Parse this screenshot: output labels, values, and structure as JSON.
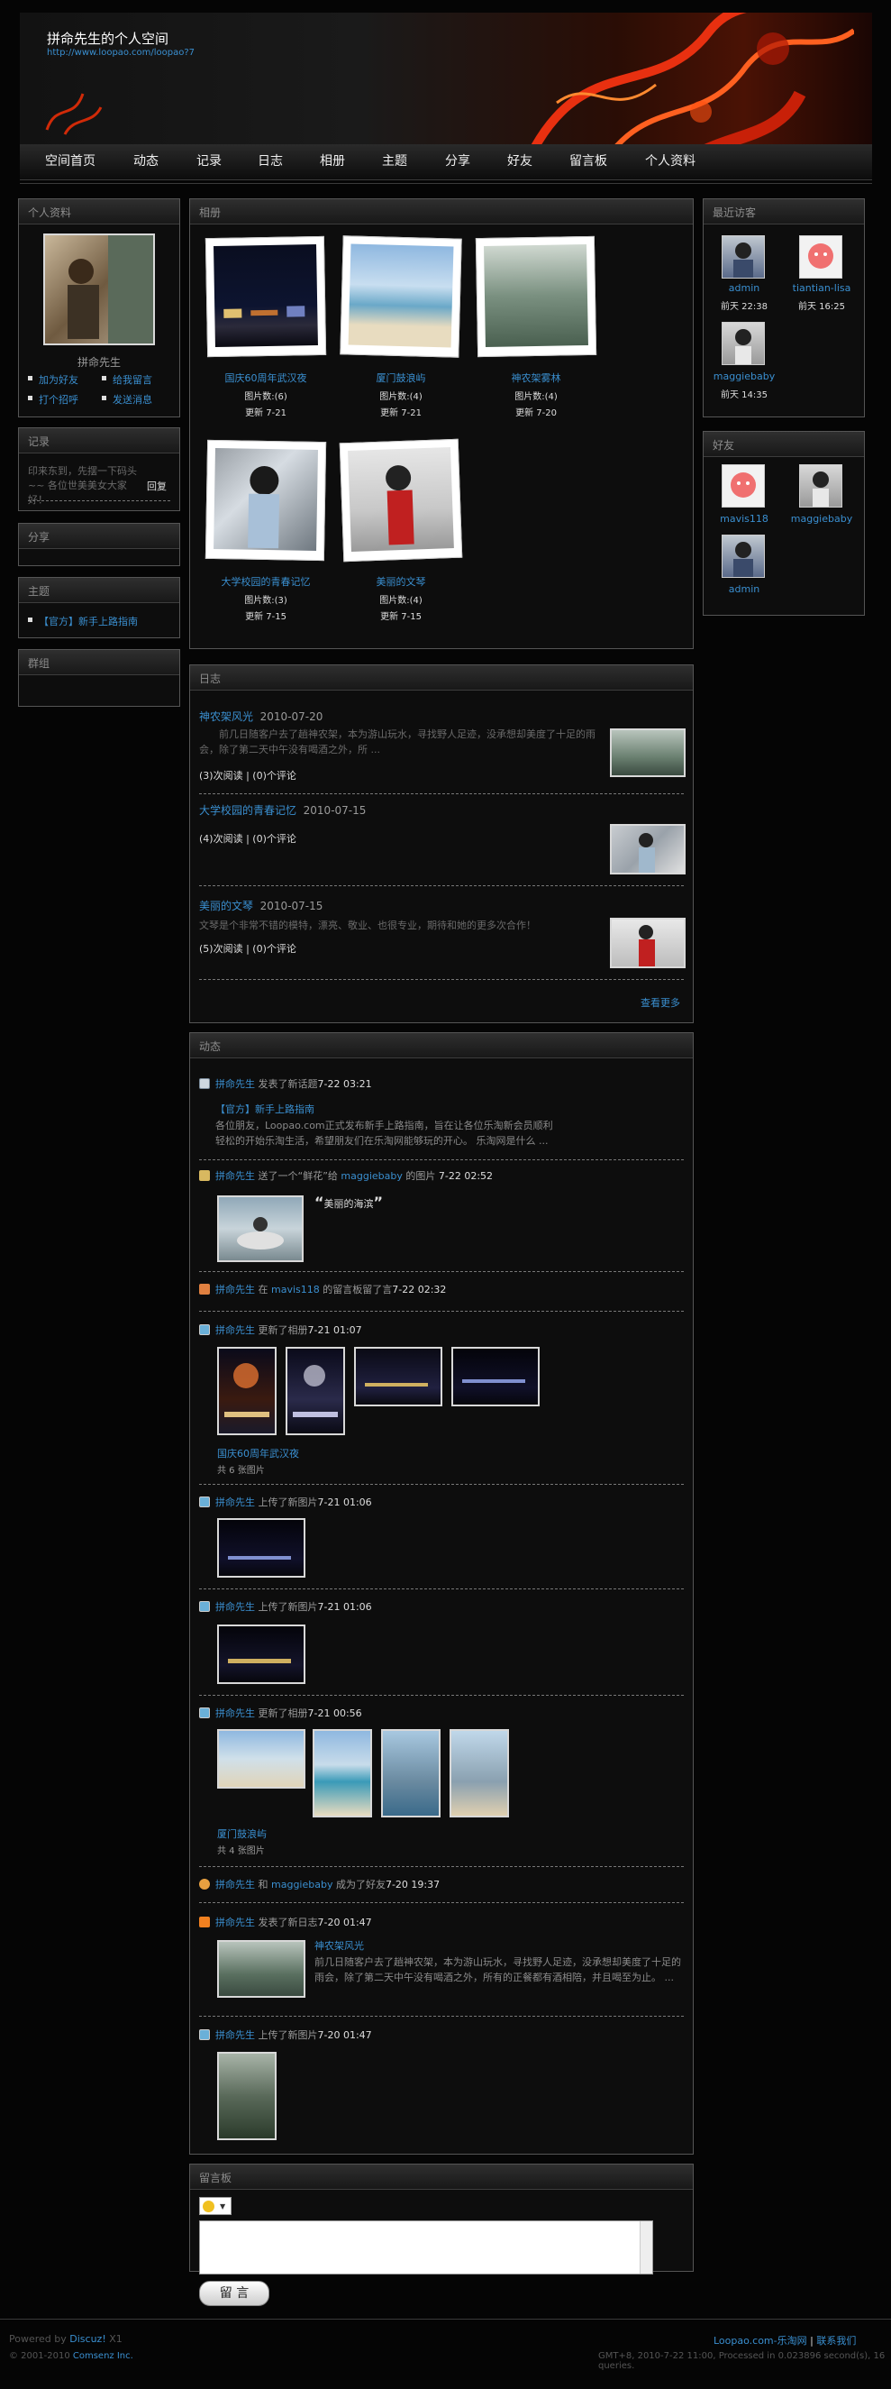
{
  "header": {
    "title": "拼命先生的个人空间",
    "url": "http://www.loopao.com/loopao?7"
  },
  "nav": [
    "空间首页",
    "动态",
    "记录",
    "日志",
    "相册",
    "主题",
    "分享",
    "好友",
    "留言板",
    "个人资料"
  ],
  "profile": {
    "panel_title": "个人资料",
    "name": "拼命先生",
    "links": [
      "加为好友",
      "给我留言",
      "打个招呼",
      "发送消息"
    ]
  },
  "record": {
    "panel_title": "记录",
    "text": "印来东到，先摆一下码头~~ 各位世美美女大家好！",
    "reply": "回复"
  },
  "share": {
    "panel_title": "分享"
  },
  "topics": {
    "panel_title": "主题",
    "items": [
      "【官方】新手上路指南"
    ]
  },
  "groups": {
    "panel_title": "群组"
  },
  "albums": {
    "panel_title": "相册",
    "items": [
      {
        "name": "国庆60周年武汉夜",
        "count": "图片数:(6)",
        "updated": "更新 7-21"
      },
      {
        "name": "厦门鼓浪屿",
        "count": "图片数:(4)",
        "updated": "更新 7-21"
      },
      {
        "name": "神农架雾林",
        "count": "图片数:(4)",
        "updated": "更新 7-20"
      },
      {
        "name": "大学校园的青春记忆",
        "count": "图片数:(3)",
        "updated": "更新 7-15"
      },
      {
        "name": "美丽的文琴",
        "count": "图片数:(4)",
        "updated": "更新 7-15"
      }
    ]
  },
  "blog": {
    "panel_title": "日志",
    "entries": [
      {
        "title": "神农架风光",
        "date": "2010-07-20",
        "excerpt": "前几日随客户去了趟神农架，本为游山玩水，寻找野人足迹，没承想却美度了十足的雨会，除了第二天中午没有喝酒之外，所 ...",
        "stats": "(3)次阅读 | (0)个评论"
      },
      {
        "title": "大学校园的青春记忆",
        "date": "2010-07-15",
        "excerpt": "",
        "stats": "(4)次阅读 | (0)个评论"
      },
      {
        "title": "美丽的文琴",
        "date": "2010-07-15",
        "excerpt": "文琴是个非常不错的模特，漂亮、敬业、也很专业，期待和她的更多次合作！",
        "stats": "(5)次阅读 | (0)个评论"
      }
    ],
    "more": "查看更多"
  },
  "feed": {
    "panel_title": "动态",
    "items": [
      {
        "user": "拼命先生",
        "action": "发表了新话题",
        "time": "7-22 03:21",
        "title": "【官方】新手上路指南",
        "body": "各位朋友，Loopao.com正式发布新手上路指南，旨在让各位乐淘新会员顺利轻松的开始乐淘生活，希望朋友们在乐淘网能够玩的开心。 乐淘网是什么 ..."
      },
      {
        "user": "拼命先生",
        "action_pre": "送了一个“鲜花”给",
        "target": "maggiebaby",
        "action_post": "的图片",
        "time": "7-22 02:52",
        "quote": "美丽的海滨"
      },
      {
        "user": "拼命先生",
        "action_pre": "在",
        "target": "mavis118",
        "action_post": "的留言板留了言",
        "time": "7-22 02:32"
      },
      {
        "user": "拼命先生",
        "action": "更新了相册",
        "time": "7-21 01:07",
        "album": "国庆60周年武汉夜",
        "count": "共 6 张图片"
      },
      {
        "user": "拼命先生",
        "action": "上传了新图片",
        "time": "7-21 01:06"
      },
      {
        "user": "拼命先生",
        "action": "上传了新图片",
        "time": "7-21 01:06"
      },
      {
        "user": "拼命先生",
        "action": "更新了相册",
        "time": "7-21 00:56",
        "album": "厦门鼓浪屿",
        "count": "共 4 张图片"
      },
      {
        "user": "拼命先生",
        "action_pre": "和",
        "target": "maggiebaby",
        "action_post": "成为了好友",
        "time": "7-20 19:37"
      },
      {
        "user": "拼命先生",
        "action": "发表了新日志",
        "time": "7-20 01:47",
        "title": "神农架风光",
        "body": "前几日随客户去了趟神农架，本为游山玩水，寻找野人足迹，没承想却美度了十足的雨会，除了第二天中午没有喝酒之外，所有的正餐都有酒相陪，并且喝至为止。 ..."
      },
      {
        "user": "拼命先生",
        "action": "上传了新图片",
        "time": "7-20 01:47"
      }
    ]
  },
  "guestbook": {
    "panel_title": "留言板",
    "submit": "留 言"
  },
  "visitors": {
    "panel_title": "最近访客",
    "items": [
      {
        "name": "admin",
        "time": "前天 22:38"
      },
      {
        "name": "tiantian-lisa",
        "time": "前天 16:25"
      },
      {
        "name": "maggiebaby",
        "time": "前天 14:35"
      }
    ]
  },
  "friends": {
    "panel_title": "好友",
    "items": [
      "mavis118",
      "maggiebaby",
      "admin"
    ]
  },
  "footer": {
    "powered_pre": "Powered by",
    "powered_brand": "Discuz!",
    "powered_ver": "X1",
    "copyright_pre": "© 2001-2010",
    "copyright_brand": "Comsenz Inc.",
    "site_link": "Loopao.com-乐淘网",
    "contact": "联系我们",
    "stats": "GMT+8, 2010-7-22 11:00, Processed in 0.023896 second(s), 16 queries."
  },
  "colors": {
    "link": "#3a8fd0",
    "bg": "#050505",
    "panel_border": "#555555"
  }
}
